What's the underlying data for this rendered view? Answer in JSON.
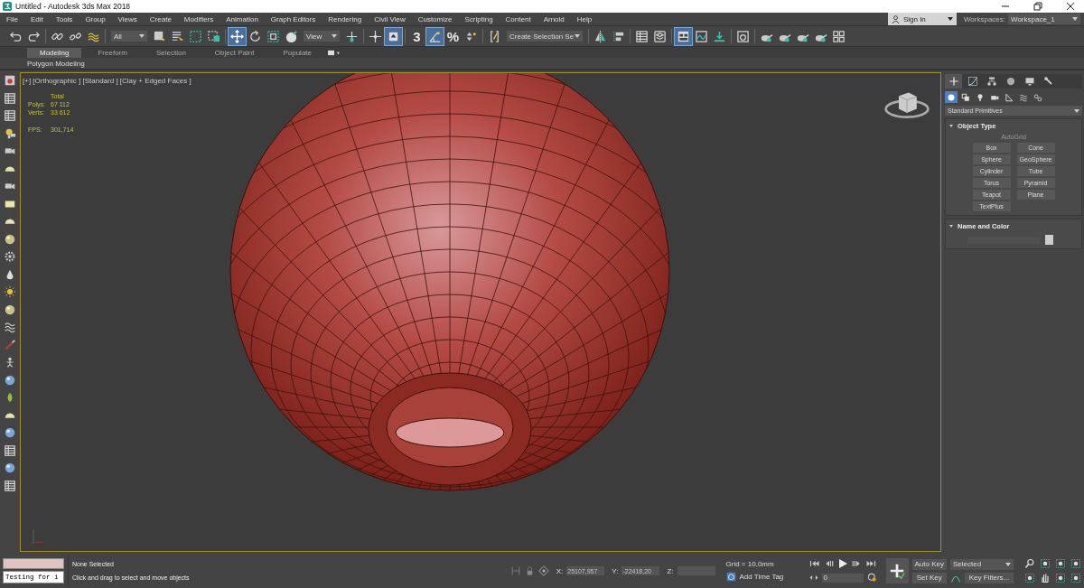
{
  "window": {
    "title": "Untitled - Autodesk 3ds Max 2018"
  },
  "menu": [
    "File",
    "Edit",
    "Tools",
    "Group",
    "Views",
    "Create",
    "Modifiers",
    "Animation",
    "Graph Editors",
    "Rendering",
    "Civil View",
    "Customize",
    "Scripting",
    "Content",
    "Arnold",
    "Help"
  ],
  "account": {
    "label": "Sign In"
  },
  "workspaces": {
    "label": "Workspaces:",
    "value": "Workspace_1"
  },
  "toolbar": [
    [
      {
        "kind": "undo",
        "selected": false
      },
      {
        "kind": "redo",
        "selected": false
      }
    ],
    [
      {
        "kind": "link",
        "selected": false
      },
      {
        "kind": "unlink",
        "selected": false
      },
      {
        "kind": "bind",
        "selected": false
      }
    ],
    [
      {
        "kind": "dropdown",
        "value": "All"
      },
      {
        "kind": "select",
        "selected": false
      },
      {
        "kind": "select-list",
        "selected": false
      },
      {
        "kind": "region",
        "selected": false
      },
      {
        "kind": "crossing",
        "selected": false
      }
    ],
    [
      {
        "kind": "move",
        "selected": true
      },
      {
        "kind": "rotate",
        "selected": false
      },
      {
        "kind": "scale",
        "selected": false
      },
      {
        "kind": "place",
        "selected": false
      },
      {
        "kind": "dropdown",
        "value": "View"
      },
      {
        "kind": "pivot",
        "selected": false
      }
    ],
    [
      {
        "kind": "manipulate",
        "selected": false
      },
      {
        "kind": "shortcut",
        "selected": true
      }
    ],
    [
      {
        "kind": "glyph",
        "glyph": "3",
        "selected": false
      },
      {
        "kind": "angle",
        "selected": true
      },
      {
        "kind": "glyph",
        "glyph": "%",
        "selected": false
      },
      {
        "kind": "spinner",
        "selected": false
      }
    ],
    [
      {
        "kind": "bracket",
        "selected": false
      },
      {
        "kind": "dropdown",
        "value": "Create Selection Se"
      }
    ],
    [
      {
        "kind": "mirror",
        "selected": false
      },
      {
        "kind": "align",
        "selected": false
      }
    ],
    [
      {
        "kind": "table",
        "selected": false
      },
      {
        "kind": "layers",
        "selected": false
      }
    ],
    [
      {
        "kind": "ribbon",
        "selected": true
      },
      {
        "kind": "curve",
        "selected": false
      },
      {
        "kind": "arrow-down",
        "selected": false
      }
    ],
    [
      {
        "kind": "material",
        "selected": false
      }
    ],
    [
      {
        "kind": "teapot",
        "selected": false
      },
      {
        "kind": "teapot",
        "selected": false
      },
      {
        "kind": "teapot",
        "selected": false
      },
      {
        "kind": "teapot",
        "selected": false
      },
      {
        "kind": "panels",
        "selected": false
      }
    ]
  ],
  "ribbon_tabs": [
    {
      "label": "Modeling",
      "selected": true
    },
    {
      "label": "Freeform",
      "selected": false
    },
    {
      "label": "Selection",
      "selected": false
    },
    {
      "label": "Object Paint",
      "selected": false
    },
    {
      "label": "Populate",
      "selected": false
    }
  ],
  "ribbon_panel": "Polygon Modeling",
  "viewport": {
    "label": "[+] [Orthographic ] [Standard ] [Clay + Edged Faces ]",
    "stats_header": "Total",
    "stats": [
      {
        "label": "Polys:",
        "value": "67 112"
      },
      {
        "label": "Verts:",
        "value": "33 612"
      }
    ],
    "fps": {
      "label": "FPS:",
      "value": "301,714"
    }
  },
  "command_panel": {
    "tabs": [
      {
        "kind": "create",
        "selected": true
      },
      {
        "kind": "modify",
        "selected": false
      },
      {
        "kind": "hierarchy",
        "selected": false
      },
      {
        "kind": "motion",
        "selected": false
      },
      {
        "kind": "display",
        "selected": false
      },
      {
        "kind": "utilities",
        "selected": false
      }
    ],
    "categories": [
      {
        "kind": "geometry",
        "selected": true
      },
      {
        "kind": "shapes",
        "selected": false
      },
      {
        "kind": "lights",
        "selected": false
      },
      {
        "kind": "cameras",
        "selected": false
      },
      {
        "kind": "helpers",
        "selected": false
      },
      {
        "kind": "spacewarps",
        "selected": false
      },
      {
        "kind": "systems",
        "selected": false
      }
    ],
    "dropdown": "Standard Primitives",
    "object_type": {
      "title": "Object Type",
      "expanded": true,
      "autogrid": {
        "label": "AutoGrid",
        "disabled": true
      },
      "buttons": [
        "Box",
        "Cone",
        "Sphere",
        "GeoSphere",
        "Cylinder",
        "Tube",
        "Torus",
        "Pyramid",
        "Teapot",
        "Plane",
        "TextPlus"
      ]
    },
    "name_and_color": {
      "title": "Name and Color",
      "expanded": true
    }
  },
  "status": {
    "listener_value": "Testing for i",
    "selection": "None Selected",
    "prompt": "Click and drag to select and move objects",
    "x": {
      "label": "X:",
      "value": "25107,957"
    },
    "y": {
      "label": "Y:",
      "value": "-22418,20"
    },
    "z": {
      "label": "Z:"
    },
    "grid": "Grid = 10,0mm",
    "time_tag": "Add Time Tag",
    "frame": "0",
    "auto_key": "Auto Key",
    "key_mode": "Selected",
    "set_key": "Set Key",
    "key_filters": "Key Filters..."
  }
}
